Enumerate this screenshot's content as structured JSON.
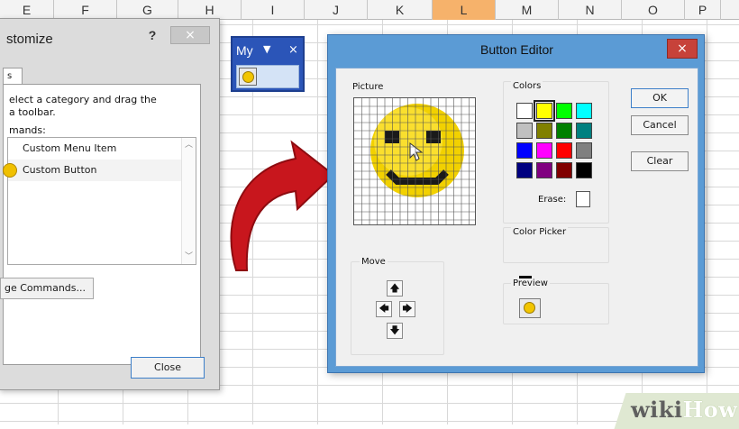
{
  "spreadsheet": {
    "columns": [
      "E",
      "F",
      "G",
      "H",
      "I",
      "J",
      "K",
      "L",
      "M",
      "N",
      "O",
      "P"
    ],
    "selected_column": "L"
  },
  "customize": {
    "title": "stomize",
    "help_label": "?",
    "close_label": "×",
    "tab_label": "s",
    "instructions": "elect a category and drag the\n a toolbar.",
    "commands_label": "mands:",
    "commands": [
      "Custom Menu Item",
      "Custom Button"
    ],
    "rearrange_label": "ge Commands...",
    "close_button": "Close"
  },
  "my_toolbar": {
    "title": "My",
    "dropdown_icon": "▼",
    "close_label": "×"
  },
  "button_editor": {
    "title": "Button Editor",
    "close_label": "×",
    "picture_label": "Picture",
    "colors_label": "Colors",
    "erase_label": "Erase:",
    "color_picker_label": "Color Picker",
    "move_label": "Move",
    "preview_label": "Preview",
    "ok_label": "OK",
    "cancel_label": "Cancel",
    "clear_label": "Clear",
    "palette": [
      "#ffffff",
      "#ffff00",
      "#00ff00",
      "#00ffff",
      "#c0c0c0",
      "#808000",
      "#008000",
      "#008080",
      "#0000ff",
      "#ff00ff",
      "#ff0000",
      "#808080",
      "#000080",
      "#800080",
      "#800000",
      "#000000"
    ],
    "selected_color_index": 1,
    "picker_color": "#000000",
    "move_arrows": {
      "up": "🡅",
      "left": "🡄",
      "right": "🡆",
      "down": "🡇"
    }
  },
  "watermark": {
    "wiki": "wiki",
    "how": "How"
  },
  "colors": {
    "editor_frame": "#5b9bd5",
    "close_red": "#c7423a",
    "toolbar_blue": "#2b55b8",
    "arrow_red": "#c8161d",
    "highlight_column": "#f6b26b"
  }
}
